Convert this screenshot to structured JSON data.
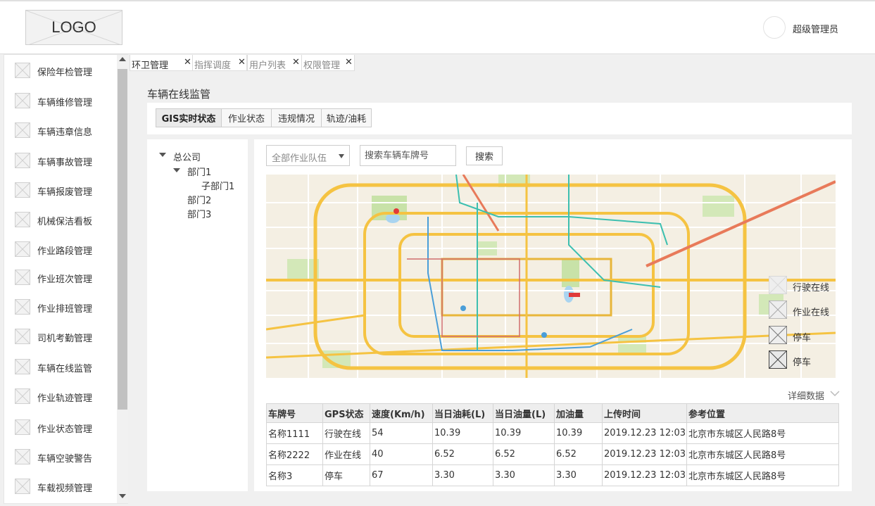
{
  "header": {
    "logo_text": "LOGO",
    "username": "超级管理员"
  },
  "sidebar": {
    "items": [
      {
        "label": "保险年检管理"
      },
      {
        "label": "车辆维修管理"
      },
      {
        "label": "车辆违章信息"
      },
      {
        "label": "车辆事故管理"
      },
      {
        "label": "车辆报废管理"
      },
      {
        "label": "机械保洁看板"
      },
      {
        "label": "作业路段管理"
      },
      {
        "label": "作业班次管理"
      },
      {
        "label": "作业排班管理"
      },
      {
        "label": "司机考勤管理"
      },
      {
        "label": "车辆在线监管"
      },
      {
        "label": "作业轨迹管理"
      },
      {
        "label": "作业状态管理"
      },
      {
        "label": "车辆空驶警告"
      },
      {
        "label": "车载视频管理"
      }
    ]
  },
  "tabs": [
    {
      "label": "环卫管理",
      "close": "✕",
      "active": true
    },
    {
      "label": "指挥调度",
      "close": "✕",
      "active": false
    },
    {
      "label": "用户列表",
      "close": "✕",
      "active": false
    },
    {
      "label": "权限管理",
      "close": "✕",
      "active": false
    }
  ],
  "page": {
    "title": "车辆在线监管"
  },
  "subtabs": [
    {
      "label": "GIS实时状态",
      "active": true
    },
    {
      "label": "作业状态",
      "active": false
    },
    {
      "label": "违规情况",
      "active": false
    },
    {
      "label": "轨迹/油耗",
      "active": false
    }
  ],
  "tree": {
    "root": "总公司",
    "dept1": "部门1",
    "sub1": "子部门1",
    "dept2": "部门2",
    "dept3": "部门3"
  },
  "filters": {
    "team_select_value": "全部作业队伍",
    "search_placeholder": "搜索车辆车牌号",
    "search_button": "搜索"
  },
  "legend": [
    {
      "label": "行驶在线"
    },
    {
      "label": "作业在线"
    },
    {
      "label": "停车"
    },
    {
      "label": "停车"
    }
  ],
  "detail_toggle": "详细数据",
  "table": {
    "headers": [
      "车牌号",
      "GPS状态",
      "速度(Km/h)",
      "当日油耗(L)",
      "当日油量(L)",
      "加油量",
      "上传时间",
      "参考位置"
    ],
    "rows": [
      [
        "名称1111",
        "行驶在线",
        "54",
        "10.39",
        "10.39",
        "10.39",
        "2019.12.23 12:03",
        "北京市东城区人民路8号"
      ],
      [
        "名称2222",
        "作业在线",
        "40",
        "6.52",
        "6.52",
        "6.52",
        "2019.12.23 12:03",
        "北京市东城区人民路8号"
      ],
      [
        "名称3",
        "停车",
        "67",
        "3.30",
        "3.30",
        "3.30",
        "2019.12.23 12:03",
        "北京市东城区人民路8号"
      ]
    ]
  },
  "colors": {
    "map_background": "#f4efe3",
    "major_road": "#f5c342",
    "ring_road": "#e8b63a",
    "subway_blue": "#4a9ed8",
    "subway_teal": "#3cbfb0",
    "park_green": "#c8e2a8"
  }
}
